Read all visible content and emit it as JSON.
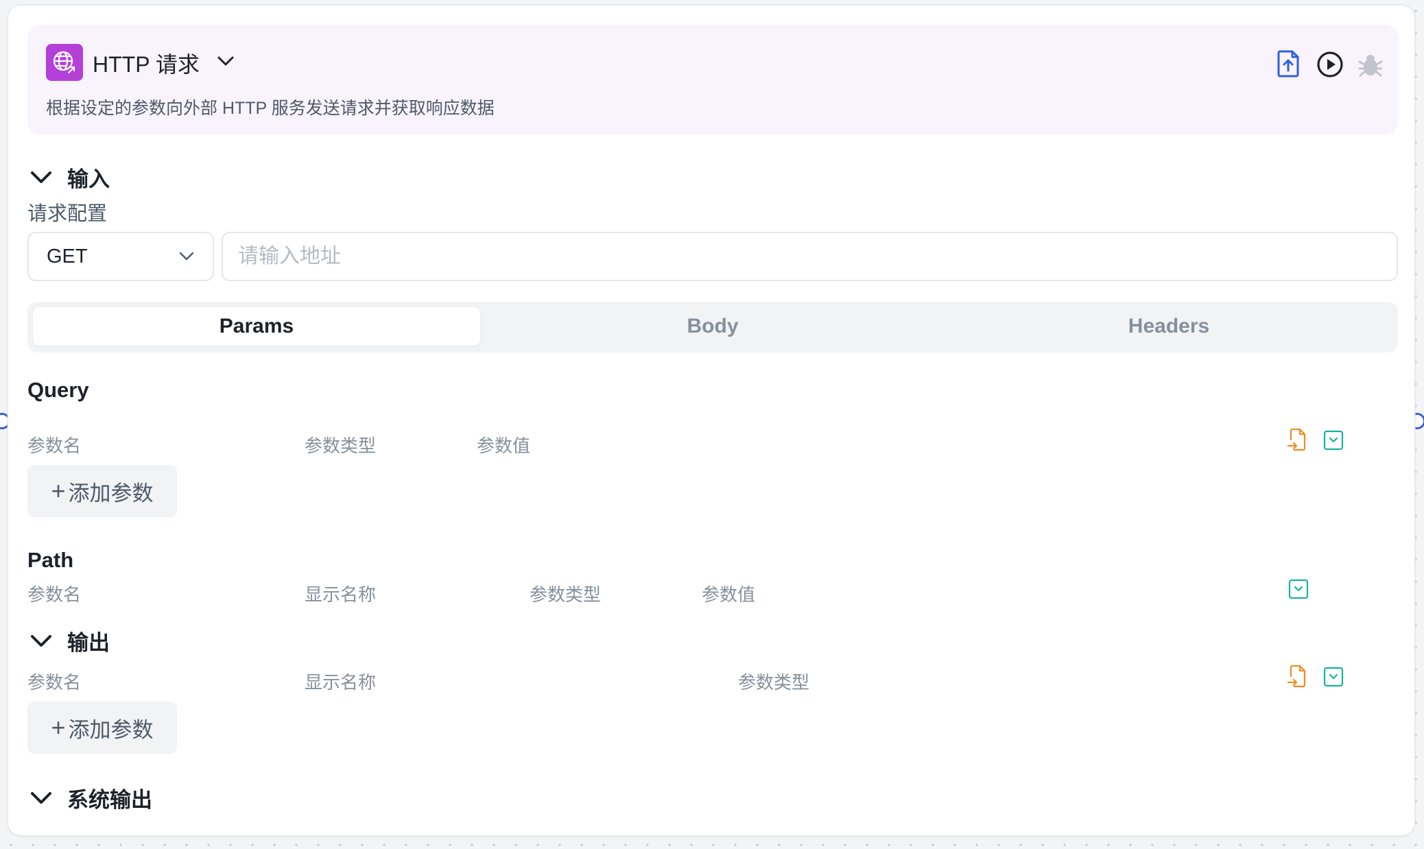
{
  "node": {
    "title": "HTTP 请求",
    "description": "根据设定的参数向外部 HTTP 服务发送请求并获取响应数据",
    "accent_color": "#b53fd9",
    "icon": "globe-link-icon",
    "actions": [
      "upload-file-icon",
      "play-circle-icon",
      "bug-icon"
    ]
  },
  "input_section": {
    "title": "输入",
    "request_config_label": "请求配置",
    "method": "GET",
    "url_placeholder": "请输入地址",
    "url_value": "",
    "tabs": [
      "Params",
      "Body",
      "Headers"
    ],
    "active_tab": "Params"
  },
  "query": {
    "title": "Query",
    "columns": [
      "参数名",
      "参数类型",
      "参数值"
    ],
    "add_label": "添加参数"
  },
  "path": {
    "title": "Path",
    "columns": [
      "参数名",
      "显示名称",
      "参数类型",
      "参数值"
    ]
  },
  "output_section": {
    "title": "输出",
    "columns": [
      "参数名",
      "显示名称",
      "参数类型"
    ],
    "add_label": "添加参数"
  },
  "system_output": {
    "title": "系统输出"
  }
}
